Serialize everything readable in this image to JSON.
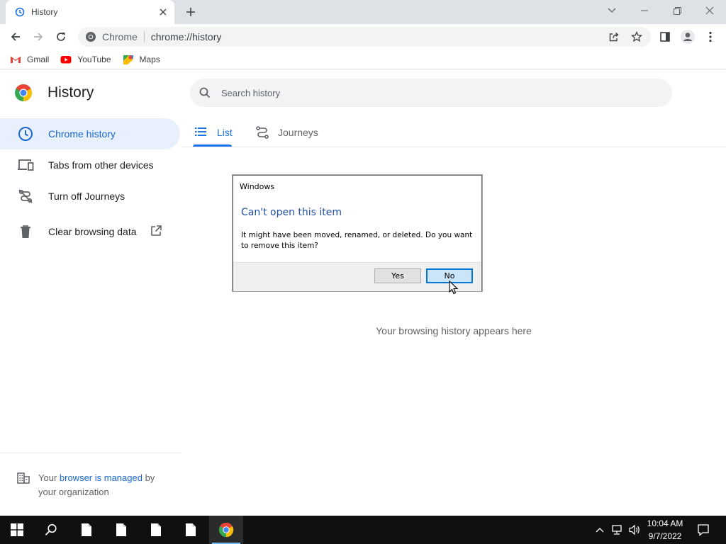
{
  "browser": {
    "tab_title": "History",
    "address_site": "Chrome",
    "address_url": "chrome://history"
  },
  "bookmarks": [
    {
      "label": "Gmail",
      "icon": "gmail-icon"
    },
    {
      "label": "YouTube",
      "icon": "youtube-icon"
    },
    {
      "label": "Maps",
      "icon": "maps-icon"
    }
  ],
  "history": {
    "title": "History",
    "search_placeholder": "Search history",
    "sidebar": [
      {
        "label": "Chrome history",
        "icon": "clock-icon",
        "active": true
      },
      {
        "label": "Tabs from other devices",
        "icon": "devices-icon"
      },
      {
        "label": "Turn off Journeys",
        "icon": "journeys-off-icon"
      },
      {
        "label": "Clear browsing data",
        "icon": "trash-icon"
      }
    ],
    "tabs": [
      {
        "label": "List",
        "active": true
      },
      {
        "label": "Journeys"
      }
    ],
    "empty_message": "Your browsing history appears here",
    "managed": {
      "prefix": "Your ",
      "link": "browser is managed",
      "suffix": " by your organization"
    }
  },
  "dialog": {
    "caption": "Windows",
    "heading": "Can't open this item",
    "message": "It might have been moved, renamed, or deleted. Do you want to remove this item?",
    "yes_label": "Yes",
    "no_label": "No"
  },
  "taskbar": {
    "time": "10:04 AM",
    "date": "9/7/2022"
  },
  "colors": {
    "accent": "#1a73e8",
    "active_bg": "#e8f0fe",
    "dialog_heading": "#1e4fa3",
    "taskbar": "#101010"
  }
}
